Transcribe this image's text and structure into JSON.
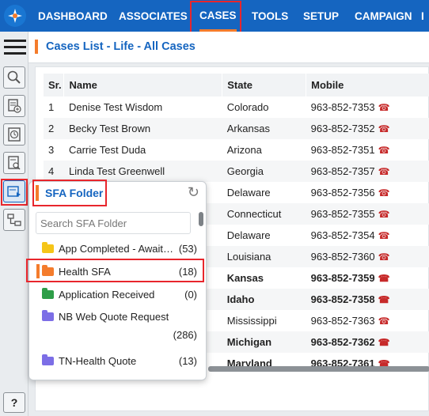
{
  "nav": {
    "items": [
      {
        "label": "DASHBOARD"
      },
      {
        "label": "ASSOCIATES"
      },
      {
        "label": "CASES"
      },
      {
        "label": "TOOLS"
      },
      {
        "label": "SETUP"
      },
      {
        "label": "CAMPAIGN"
      }
    ],
    "active": "CASES"
  },
  "page": {
    "title": "Cases List - Life - All Cases"
  },
  "table": {
    "columns": [
      "Sr.",
      "Name",
      "State",
      "Mobile"
    ],
    "rows": [
      {
        "sr": "1",
        "name": "Denise Test Wisdom",
        "state": "Colorado",
        "mobile": "963-852-7353"
      },
      {
        "sr": "2",
        "name": "Becky Test Brown",
        "state": "Arkansas",
        "mobile": "963-852-7352"
      },
      {
        "sr": "3",
        "name": "Carrie Test Duda",
        "state": "Arizona",
        "mobile": "963-852-7351"
      },
      {
        "sr": "4",
        "name": "Linda Test Greenwell",
        "state": "Georgia",
        "mobile": "963-852-7357"
      },
      {
        "sr": "",
        "name": "",
        "state": "Delaware",
        "mobile": "963-852-7356"
      },
      {
        "sr": "",
        "name": "",
        "state": "Connecticut",
        "mobile": "963-852-7355"
      },
      {
        "sr": "",
        "name": "",
        "state": "Delaware",
        "mobile": "963-852-7354"
      },
      {
        "sr": "",
        "name": "",
        "state": "Louisiana",
        "mobile": "963-852-7360"
      },
      {
        "sr": "",
        "name": "",
        "state": "Kansas",
        "mobile": "963-852-7359",
        "bold": true
      },
      {
        "sr": "",
        "name": "",
        "state": "Idaho",
        "mobile": "963-852-7358",
        "bold": true
      },
      {
        "sr": "",
        "name": "",
        "state": "Mississippi",
        "mobile": "963-852-7363"
      },
      {
        "sr": "",
        "name": "",
        "state": "Michigan",
        "mobile": "963-852-7362",
        "bold": true
      },
      {
        "sr": "",
        "name": "",
        "state": "Maryland",
        "mobile": "963-852-7361",
        "bold": true
      }
    ]
  },
  "sfa": {
    "title": "SFA Folder",
    "search_placeholder": "Search SFA Folder",
    "folders": [
      {
        "name": "App Completed - Awaiting...",
        "count": "(53)",
        "color": "#f5c518"
      },
      {
        "name": "Health SFA",
        "count": "(18)",
        "color": "#f47c2c",
        "selected": true
      },
      {
        "name": "Application Received",
        "count": "(0)",
        "color": "#2e9e48"
      },
      {
        "name": "NB Web Quote Request",
        "count": "(286)",
        "color": "#7c6ee6"
      },
      {
        "name": "TN-Health Quote",
        "count": "(13)",
        "color": "#7c6ee6"
      }
    ]
  },
  "help": {
    "label": "?"
  },
  "colors": {
    "brand": "#1565c0",
    "accent": "#f47c2c",
    "highlight": "#e8262c"
  }
}
